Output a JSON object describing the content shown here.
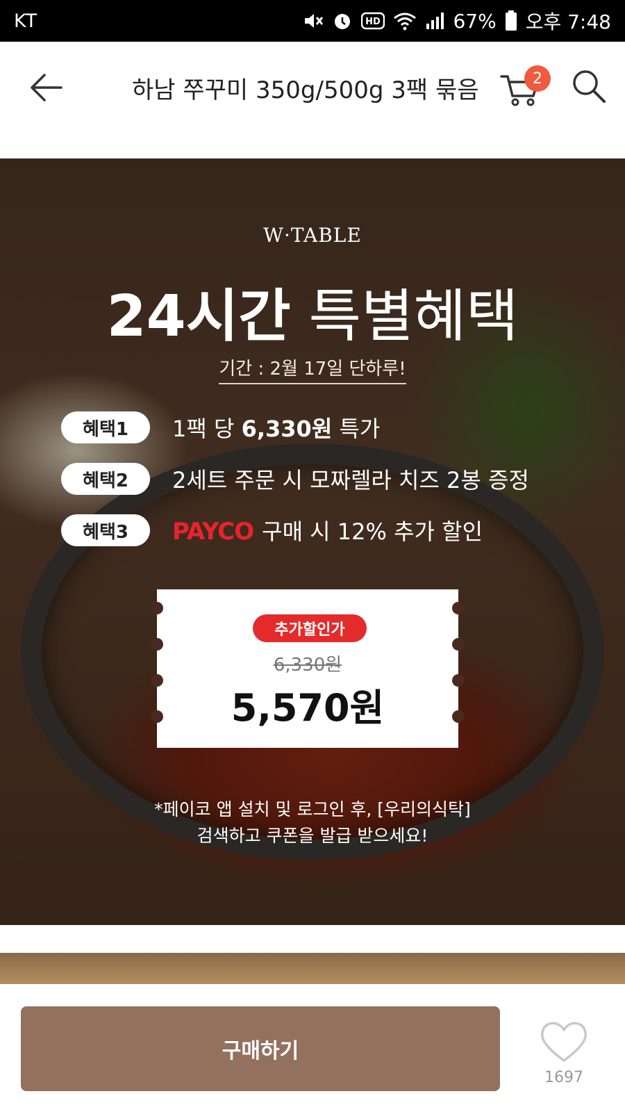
{
  "status_bar": {
    "carrier": "KT",
    "battery": "67%",
    "time": "오후 7:48",
    "icons": [
      "mute-icon",
      "alarm-icon",
      "hd-icon",
      "wifi-icon",
      "signal-icon",
      "battery-icon"
    ]
  },
  "header": {
    "title": "하남 쭈꾸미 350g/500g 3팩 묶음",
    "cart_count": "2",
    "icons": [
      "back-arrow-icon",
      "cart-icon",
      "search-icon"
    ]
  },
  "promo": {
    "brand": "W·TABLE",
    "headline_bold": "24시간",
    "headline_light": "특별혜택",
    "period": "기간 : 2월 17일 단하루!",
    "benefits": [
      {
        "label": "혜택1",
        "text_before": "1팩 당 ",
        "text_bold": "6,330원",
        "text_after": " 특가"
      },
      {
        "label": "혜택2",
        "text": "2세트 주문 시 모짜렐라 치즈 2봉 증정"
      },
      {
        "label": "혜택3",
        "payco": "PAYCO",
        "text": "구매 시 12% 추가 할인"
      }
    ],
    "ticket": {
      "tag": "추가할인가",
      "original_price": "6,330원",
      "final_price": "5,570원"
    },
    "note_line1": "*페이코 앱 설치 및 로그인 후, [우리의식탁]",
    "note_line2": "검색하고 쿠폰을 발급 받으세요!"
  },
  "bottom": {
    "buy_label": "구매하기",
    "like_count": "1697"
  },
  "colors": {
    "buy_button": "#94705f",
    "cart_badge": "#f05a3e",
    "ticket_tag": "#e32b2b",
    "payco": "#e8232d"
  }
}
